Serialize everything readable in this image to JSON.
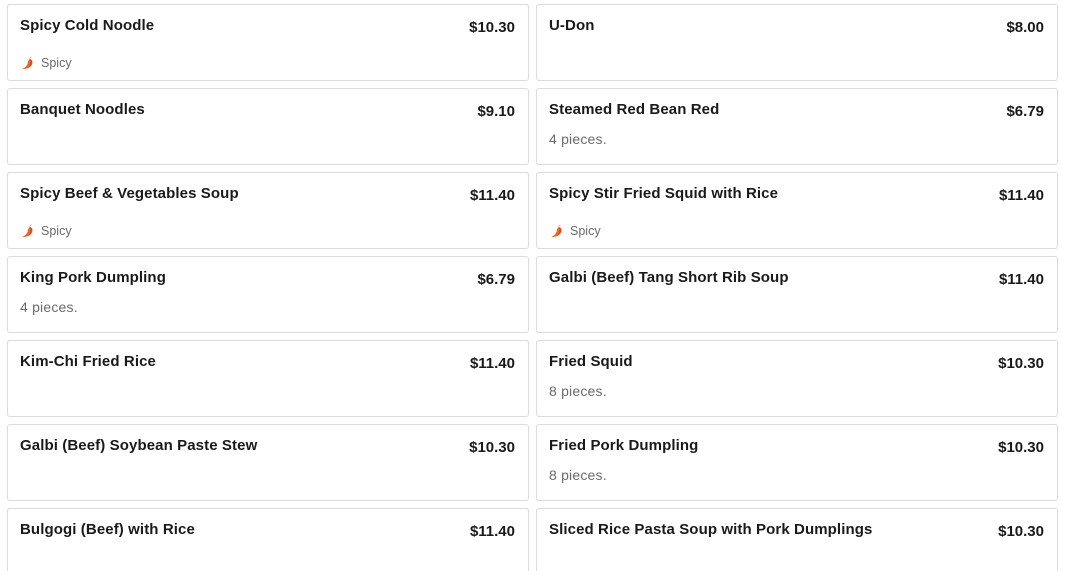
{
  "colors": {
    "chili": "#f26522",
    "chili_dark": "#d6451a"
  },
  "icons": {
    "spicy": "chili-pepper-icon"
  },
  "items": [
    {
      "name": "Spicy Cold Noodle",
      "price": "$10.30",
      "description": "",
      "tag": "Spicy"
    },
    {
      "name": "U-Don",
      "price": "$8.00",
      "description": "",
      "tag": ""
    },
    {
      "name": "Banquet Noodles",
      "price": "$9.10",
      "description": "",
      "tag": ""
    },
    {
      "name": "Steamed Red Bean Red",
      "price": "$6.79",
      "description": "4 pieces.",
      "tag": ""
    },
    {
      "name": "Spicy Beef & Vegetables Soup",
      "price": "$11.40",
      "description": "",
      "tag": "Spicy"
    },
    {
      "name": "Spicy Stir Fried Squid with Rice",
      "price": "$11.40",
      "description": "",
      "tag": "Spicy"
    },
    {
      "name": "King Pork Dumpling",
      "price": "$6.79",
      "description": "4 pieces.",
      "tag": ""
    },
    {
      "name": "Galbi (Beef) Tang Short Rib Soup",
      "price": "$11.40",
      "description": "",
      "tag": ""
    },
    {
      "name": "Kim-Chi Fried Rice",
      "price": "$11.40",
      "description": "",
      "tag": ""
    },
    {
      "name": "Fried Squid",
      "price": "$10.30",
      "description": "8 pieces.",
      "tag": ""
    },
    {
      "name": "Galbi (Beef) Soybean Paste Stew",
      "price": "$10.30",
      "description": "",
      "tag": ""
    },
    {
      "name": "Fried Pork Dumpling",
      "price": "$10.30",
      "description": "8 pieces.",
      "tag": ""
    },
    {
      "name": "Bulgogi (Beef) with Rice",
      "price": "$11.40",
      "description": "",
      "tag": ""
    },
    {
      "name": "Sliced Rice Pasta Soup with Pork Dumplings",
      "price": "$10.30",
      "description": "",
      "tag": ""
    }
  ]
}
